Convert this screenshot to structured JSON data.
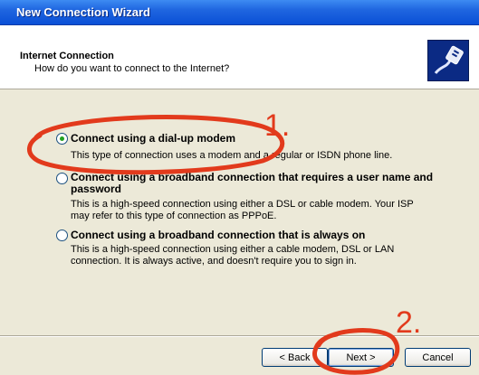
{
  "window": {
    "title": "New Connection Wizard"
  },
  "header": {
    "title": "Internet Connection",
    "subtitle": "How do you want to connect to the Internet?",
    "icon": "network-cable-icon"
  },
  "options": [
    {
      "label": "Connect using a dial-up modem",
      "description": "This type of connection uses a modem and a regular or ISDN phone line.",
      "selected": true
    },
    {
      "label": "Connect using a broadband connection that requires a user name and password",
      "description": "This is a high-speed connection using either a DSL or cable modem. Your ISP may refer to this type of connection as PPPoE.",
      "selected": false
    },
    {
      "label": "Connect using a broadband connection that is always on",
      "description": "This is a high-speed connection using either a cable modem, DSL or LAN connection. It is always active, and doesn't require you to sign in.",
      "selected": false
    }
  ],
  "buttons": {
    "back": "< Back",
    "next": "Next >",
    "cancel": "Cancel"
  },
  "annotations": {
    "step1": "1.",
    "step2": "2.",
    "color": "#e23a1c"
  }
}
